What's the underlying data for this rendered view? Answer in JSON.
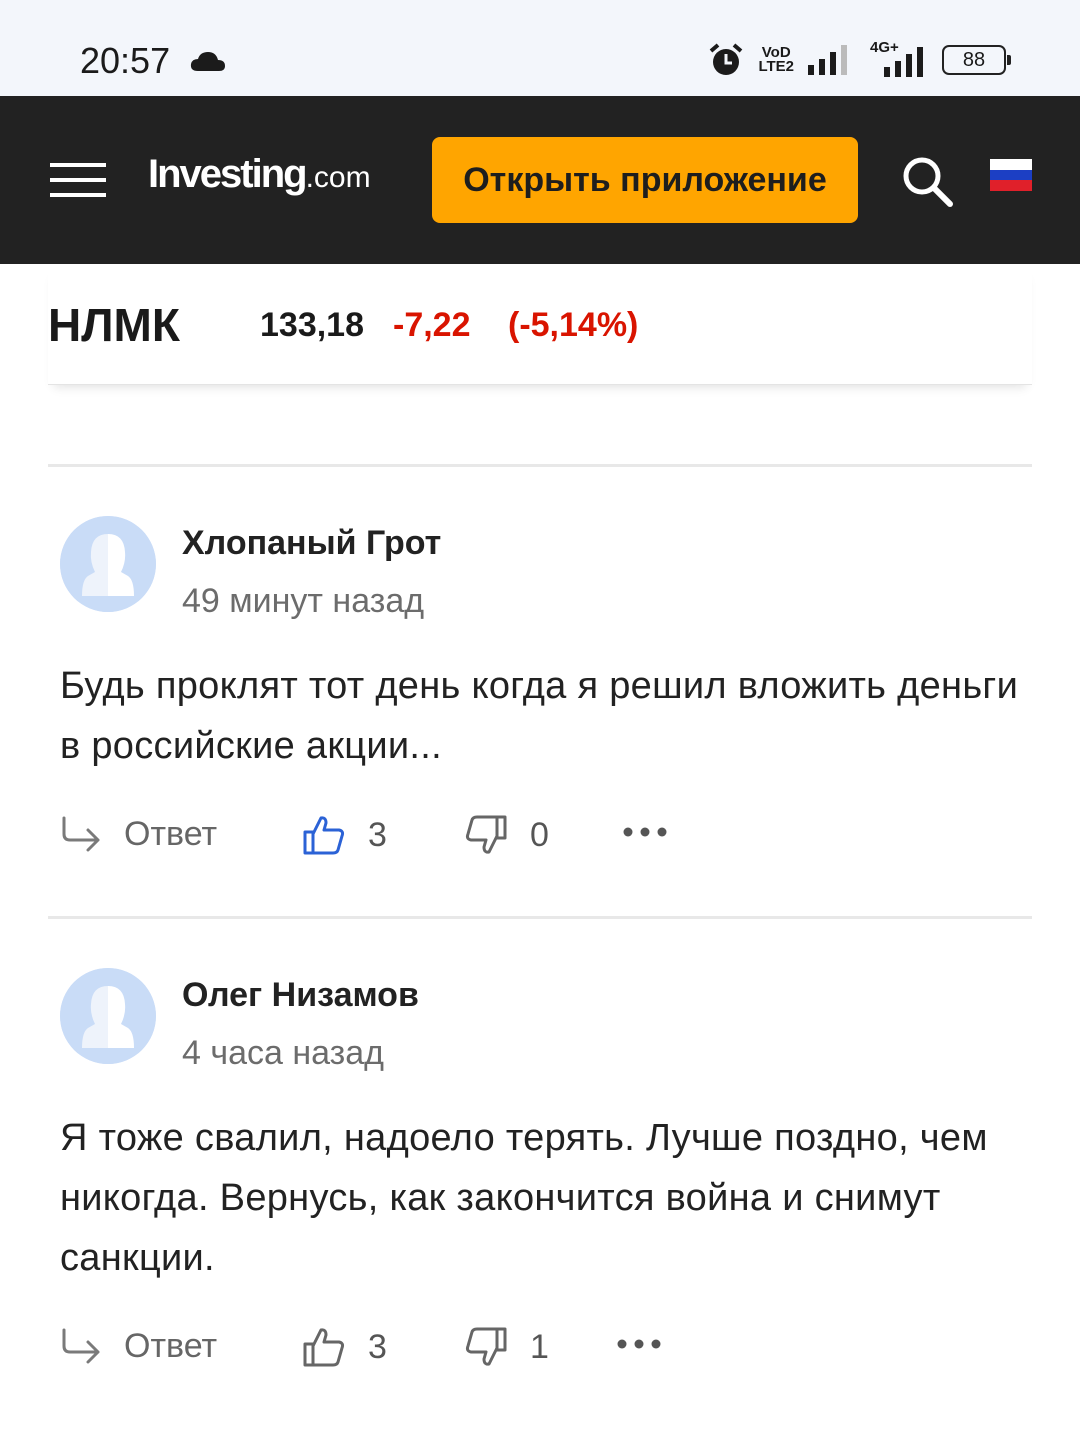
{
  "status_bar": {
    "time": "20:57",
    "volte_top": "VoD",
    "volte_bottom": "LTE2",
    "network": "4G+",
    "battery": "88"
  },
  "header": {
    "logo_main": "Investing",
    "logo_domain": ".com",
    "open_app_label": "Открыть приложение",
    "flag": [
      "#ffffff",
      "#1c3fc4",
      "#e0202a"
    ]
  },
  "stock": {
    "name": "НЛМК",
    "price": "133,18",
    "change": "-7,22",
    "change_pct": "(-5,14%)",
    "negative_color": "#d91400"
  },
  "comments": [
    {
      "author": "Хлопаный Грот",
      "time": "49 минут назад",
      "text": "Будь проклят тот день когда я решил вложить деньги в российские акции...",
      "reply_label": "Ответ",
      "likes": "3",
      "dislikes": "0"
    },
    {
      "author": "Олег Низамов",
      "time": "4 часа назад",
      "text": "Я тоже свалил, надоело терять. Лучше поздно, чем никогда. Вернусь, как закончится война и снимут санкции.",
      "reply_label": "Ответ",
      "likes": "3",
      "dislikes": "1"
    }
  ]
}
